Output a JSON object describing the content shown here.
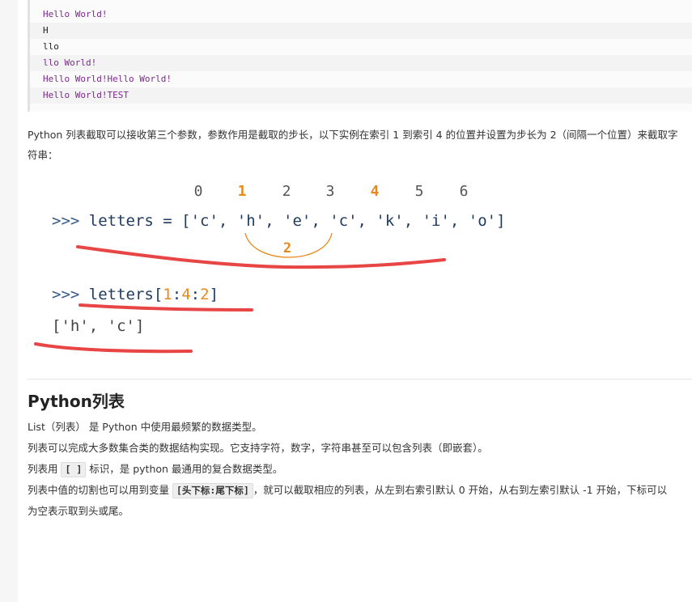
{
  "output_block": {
    "lines": [
      {
        "text": "Hello World!",
        "style": "str"
      },
      {
        "text": "H",
        "style": "plain"
      },
      {
        "text": "llo",
        "style": "plain"
      },
      {
        "text": "llo World!",
        "style": "str"
      },
      {
        "text": "Hello World!Hello World!",
        "style": "str"
      },
      {
        "text": "Hello World!TEST",
        "style": "str"
      }
    ]
  },
  "intro_paragraph": {
    "line1": "Python 列表截取可以接收第三个参数，参数作用是截取的步长，以下实例在索引 1 到索引 4 的位置并设置为步长为 2（间隔一个位置）来截取字",
    "line2": "符串："
  },
  "diagram": {
    "indices": [
      "0",
      "1",
      "2",
      "3",
      "4",
      "5",
      "6"
    ],
    "highlighted_indices": [
      "1",
      "4"
    ],
    "line1_prompt": ">>>",
    "line1_code": "letters = ['c', 'h', 'e', 'c', 'k', 'i', 'o']",
    "step_label": "2",
    "line2_prompt": ">>>",
    "line2_code_prefix": "letters[",
    "line2_start": "1",
    "line2_colon1": ":",
    "line2_stop": "4",
    "line2_colon2": ":",
    "line2_step": "2",
    "line2_code_suffix": "]",
    "result": "['h', 'c']",
    "accent_color": "#e8891c",
    "annotation_color": "#e84545"
  },
  "section": {
    "heading": "Python列表",
    "p1": "List（列表） 是 Python 中使用最频繁的数据类型。",
    "p2": "列表可以完成大多数集合类的数据结构实现。它支持字符，数字，字符串甚至可以包含列表（即嵌套）。",
    "p3_before": "列表用 ",
    "p3_code": "[ ]",
    "p3_after": " 标识，是 python 最通用的复合数据类型。",
    "p4_before": "列表中值的切割也可以用到变量 ",
    "p4_code": "[头下标:尾下标]",
    "p4_after": "，就可以截取相应的列表，从左到右索引默认 0 开始，从右到左索引默认 -1 开始，下标可以",
    "p5": "为空表示取到头或尾。"
  }
}
